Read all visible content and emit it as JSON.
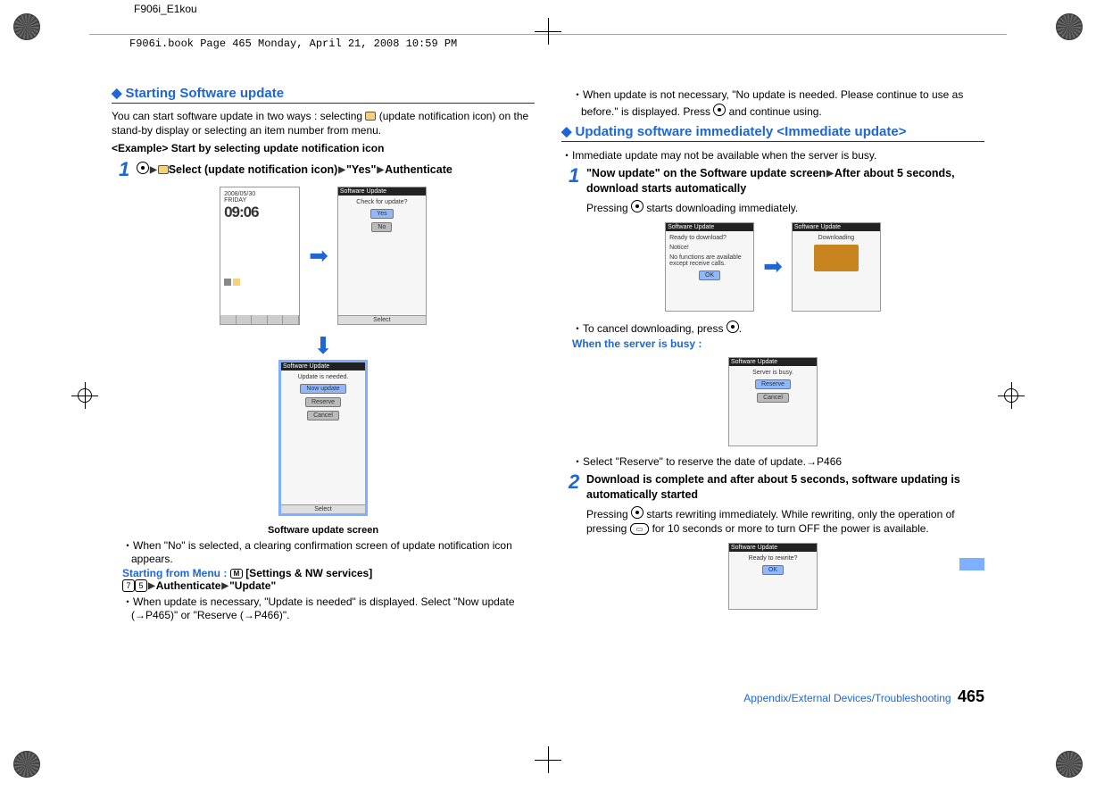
{
  "meta": {
    "doc_header": "F906i_E1kou",
    "book_header": "F906i.book  Page 465  Monday, April 21, 2008  10:59 PM"
  },
  "left": {
    "title": "Starting Software update",
    "intro": "You can start software update in two ways : selecting (update notification icon) on the stand-by display or selecting an item number from menu.",
    "example_label": "<Example> Start by selecting update notification icon",
    "step1": {
      "num": "1",
      "text_a": "Select (update notification icon)",
      "text_b": "\"Yes\"",
      "text_c": "Authenticate"
    },
    "screens": {
      "s1_date": "2008/05/30",
      "s1_day": "FRIDAY",
      "s1_time": "09:06",
      "s2_title": "Software Update",
      "s2_msg": "Check for update?",
      "s2_yes": "Yes",
      "s2_no": "No",
      "s2_foot": "Select",
      "s3_title": "Software Update",
      "s3_msg": "Update is needed.",
      "s3_b1": "Now update",
      "s3_b2": "Reserve",
      "s3_b3": "Cancel",
      "s3_foot": "Select"
    },
    "caption": "Software update screen",
    "bullet1": "When \"No\" is selected, a clearing confirmation screen of update notification icon appears.",
    "menu_label": "Starting from Menu :",
    "menu_text_a": "[Settings & NW services]",
    "menu_key1": "7",
    "menu_key2": "5",
    "menu_text_b": "Authenticate",
    "menu_text_c": "\"Update\"",
    "bullet2": "When update is necessary, \"Update is needed\" is displayed. Select \"Now update (→P465)\" or \"Reserve (→P466)\"."
  },
  "right": {
    "top_bullet": "When update is not necessary, \"No update is needed. Please continue to use as before.\" is displayed. Press  and continue using.",
    "title": "Updating software immediately <Immediate update>",
    "lead_bullet": "Immediate update may not be available when the server is busy.",
    "step1": {
      "num": "1",
      "line1": "\"Now update\" on the Software update screen",
      "line2": "After about 5 seconds, download starts automatically",
      "sub": "Pressing  starts downloading immediately."
    },
    "screens": {
      "s4_title": "Software Update",
      "s4_l1": "Ready to download?",
      "s4_l2": "Notice!",
      "s4_l3": "No functions are available except receive calls.",
      "s4_ok": "OK",
      "s5_title": "Software Update",
      "s5_msg": "Downloading",
      "s6_title": "Software Update",
      "s6_msg": "Server is busy.",
      "s6_b1": "Reserve",
      "s6_b2": "Cancel",
      "s7_title": "Software Update",
      "s7_msg": "Ready to rewrite?",
      "s7_ok": "OK"
    },
    "cancel_bullet": "To cancel downloading, press .",
    "busy_label": "When the server is busy :",
    "reserve_bullet": "Select \"Reserve\" to reserve the date of update.→P466",
    "step2": {
      "num": "2",
      "line": "Download is complete and after about 5 seconds, software updating is automatically started",
      "sub": "Pressing  starts rewriting immediately. While rewriting, only the operation of pressing  for 10 seconds or more to turn OFF the power is available."
    }
  },
  "footer": {
    "section": "Appendix/External Devices/Troubleshooting",
    "page": "465"
  }
}
